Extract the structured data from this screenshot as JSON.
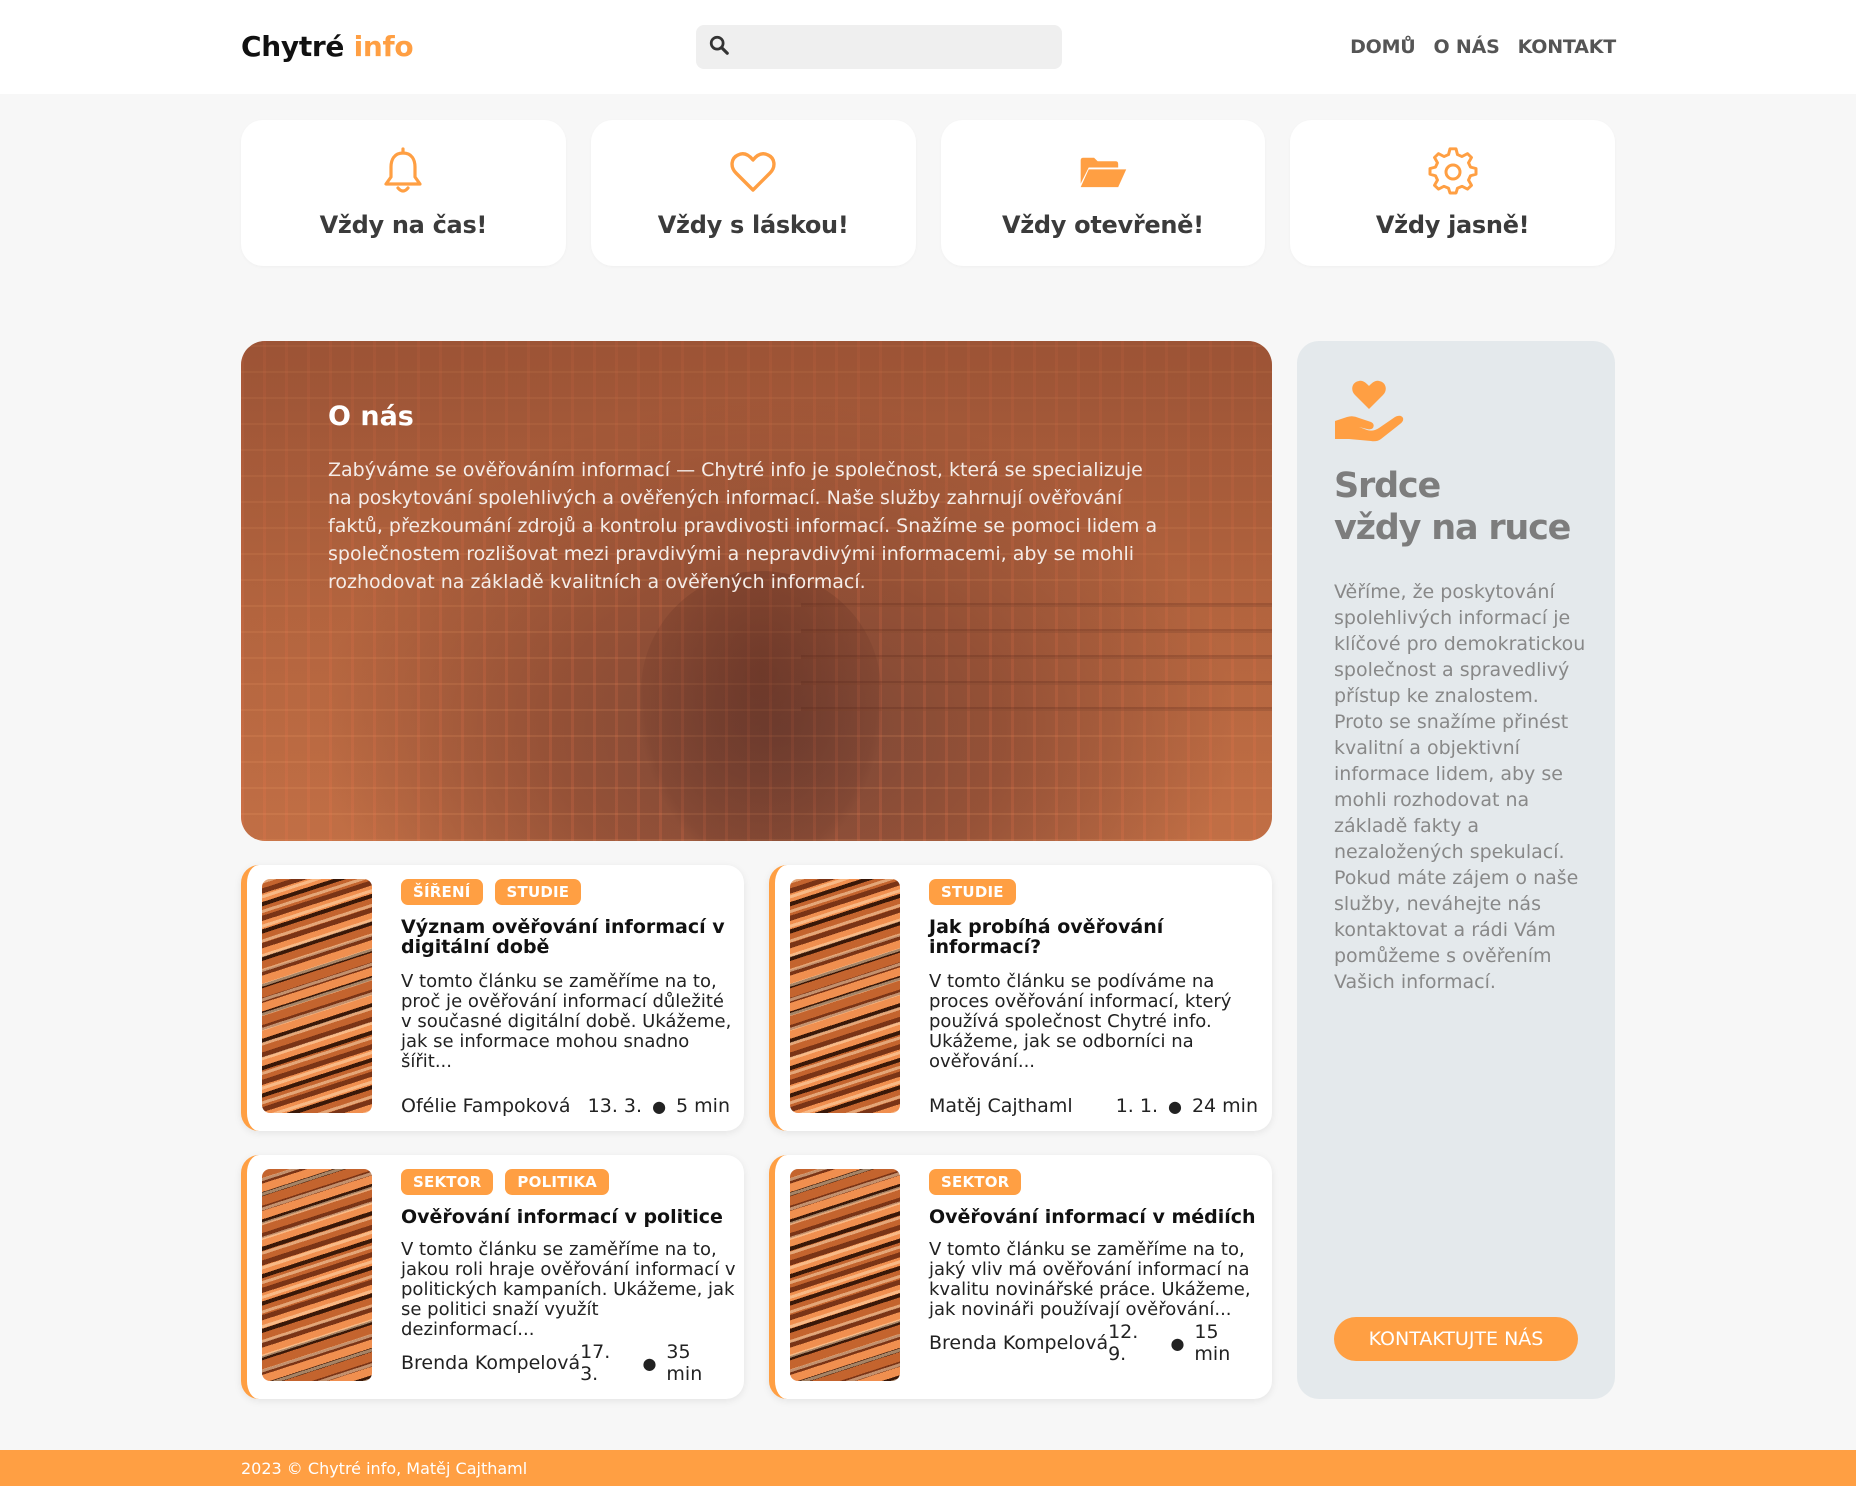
{
  "header": {
    "logo_main": "Chytré",
    "logo_accent": "info",
    "search_placeholder": "",
    "nav": [
      "DOMŮ",
      "O NÁS",
      "KONTAKT"
    ]
  },
  "features": [
    {
      "icon": "bell-icon",
      "label": "Vždy na čas!"
    },
    {
      "icon": "heart-icon",
      "label": "Vždy s láskou!"
    },
    {
      "icon": "folder-open-icon",
      "label": "Vždy otevřeně!"
    },
    {
      "icon": "gear-icon",
      "label": "Vždy jasně!"
    }
  ],
  "hero": {
    "title": "O nás",
    "text": "Zabýváme se ověřováním informací — Chytré info je společnost, která se specializuje na poskytování spolehlivých a ověřených informací. Naše služby zahrnují ověřování faktů, přezkoumání zdrojů a kontrolu pravdivosti informací. Snažíme se pomoci lidem a společnostem rozlišovat mezi pravdivými a nepravdivými informacemi, aby se mohli rozhodovat na základě kvalitních a ověřených informací."
  },
  "articles": [
    {
      "tags": [
        "ŠÍŘENÍ",
        "STUDIE"
      ],
      "title": "Význam ověřování informací v digitální době",
      "excerpt": "V tomto článku se zaměříme na to, proč je ověřování informací důležité v současné digitální době. Ukážeme, jak se informace mohou snadno šířit...",
      "author": "Ofélie Fampoková",
      "date": "13. 3.",
      "read_time": "5 min"
    },
    {
      "tags": [
        "STUDIE"
      ],
      "title": "Jak probíhá ověřování informací?",
      "excerpt": "V tomto článku se podíváme na proces ověřování informací, který používá společnost Chytré info. Ukážeme, jak se odborníci na ověřování...",
      "author": "Matěj Cajthaml",
      "date": "1. 1.",
      "read_time": "24 min"
    },
    {
      "tags": [
        "SEKTOR",
        "POLITIKA"
      ],
      "title": "Ověřování informací v politice",
      "excerpt": "V tomto článku se zaměříme na to, jakou roli hraje ověřování informací v politických kampaních. Ukážeme, jak se politici snaží využít dezinformací...",
      "author": "Brenda Kompelová",
      "date": "17. 3.",
      "read_time": "35 min"
    },
    {
      "tags": [
        "SEKTOR"
      ],
      "title": "Ověřování informací v médiích",
      "excerpt": "V tomto článku se zaměříme na to, jaký vliv má ověřování informací na kvalitu novinářské práce. Ukážeme, jak novináři používají ověřování...",
      "author": "Brenda Kompelová",
      "date": "12. 9.",
      "read_time": "15 min"
    }
  ],
  "side": {
    "icon": "hand-heart-icon",
    "title_line1": "Srdce",
    "title_line2": "vždy na ruce",
    "text": "Věříme, že poskytování spolehlivých informací je klíčové pro demokratickou společnost a spravedlivý přístup ke znalostem. Proto se snažíme přinést kvalitní a objektivní informace lidem, aby se mohli rozhodovat na základě fakty a nezaložených spekulací. Pokud máte zájem o naše služby, neváhejte nás kontaktovat a rádi Vám pomůžeme s ověřením Vašich informací.",
    "button": "KONTAKTUJTE NÁS"
  },
  "footer": {
    "text": "2023 © Chytré info, Matěj Cajthaml"
  },
  "colors": {
    "accent": "#ff9f43",
    "background": "#f7f7f7",
    "side_panel": "#e4e9ec"
  }
}
